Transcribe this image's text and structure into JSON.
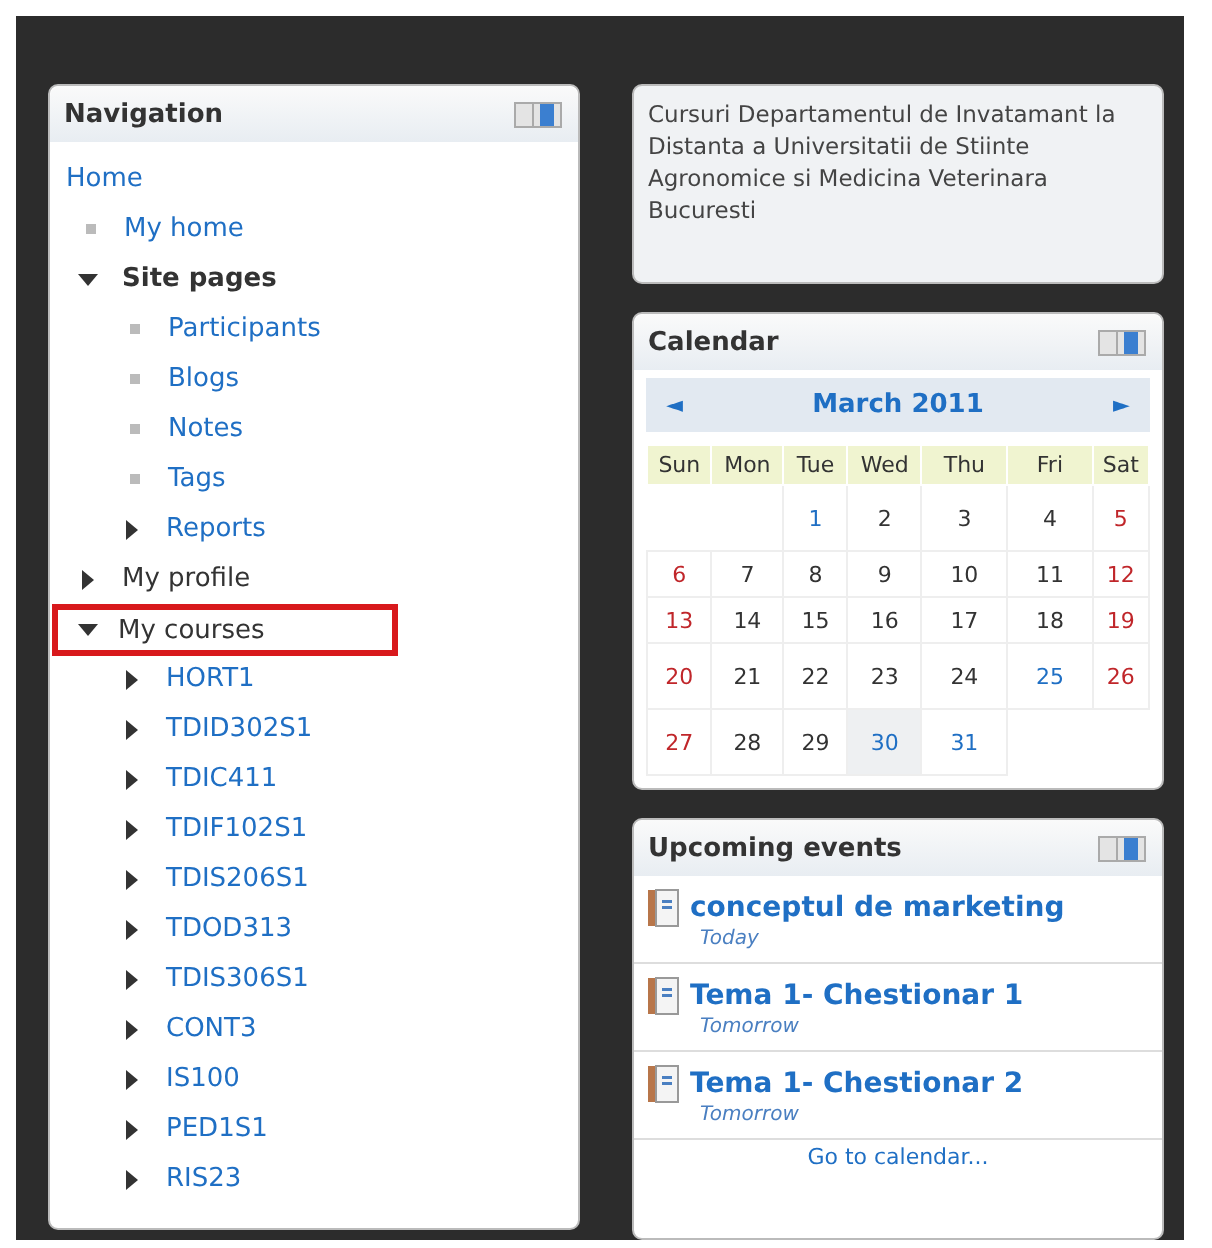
{
  "navigation": {
    "title": "Navigation",
    "items": [
      {
        "label": "Home",
        "kind": "root",
        "link": true
      },
      {
        "label": "My home",
        "kind": "leaf",
        "link": true
      },
      {
        "label": "Site pages",
        "kind": "branch",
        "link": false,
        "bold": true,
        "expanded": true,
        "children": [
          {
            "label": "Participants",
            "kind": "leaf",
            "link": true
          },
          {
            "label": "Blogs",
            "kind": "leaf",
            "link": true
          },
          {
            "label": "Notes",
            "kind": "leaf",
            "link": true
          },
          {
            "label": "Tags",
            "kind": "leaf",
            "link": true
          },
          {
            "label": "Reports",
            "kind": "branch",
            "link": true,
            "expanded": false
          }
        ]
      },
      {
        "label": "My profile",
        "kind": "branch",
        "link": false,
        "expanded": false
      },
      {
        "label": "My courses",
        "kind": "branch",
        "link": false,
        "expanded": true,
        "highlighted": true,
        "children": [
          {
            "label": "HORT1",
            "kind": "branch",
            "link": true,
            "expanded": false
          },
          {
            "label": "TDID302S1",
            "kind": "branch",
            "link": true,
            "expanded": false
          },
          {
            "label": "TDIC411",
            "kind": "branch",
            "link": true,
            "expanded": false
          },
          {
            "label": "TDIF102S1",
            "kind": "branch",
            "link": true,
            "expanded": false
          },
          {
            "label": "TDIS206S1",
            "kind": "branch",
            "link": true,
            "expanded": false
          },
          {
            "label": "TDOD313",
            "kind": "branch",
            "link": true,
            "expanded": false
          },
          {
            "label": "TDIS306S1",
            "kind": "branch",
            "link": true,
            "expanded": false
          },
          {
            "label": "CONT3",
            "kind": "branch",
            "link": true,
            "expanded": false
          },
          {
            "label": "IS100",
            "kind": "branch",
            "link": true,
            "expanded": false
          },
          {
            "label": "PED1S1",
            "kind": "branch",
            "link": true,
            "expanded": false
          },
          {
            "label": "RIS23",
            "kind": "branch",
            "link": true,
            "expanded": false
          }
        ]
      }
    ]
  },
  "info": {
    "text": "Cursuri Departamentul de Invatamant la Distanta a Universitatii de Stiinte Agronomice si Medicina Veterinara Bucuresti"
  },
  "calendar": {
    "title": "Calendar",
    "prev": "◄",
    "month": "March 2011",
    "next": "►",
    "weekdays": [
      "Sun",
      "Mon",
      "Tue",
      "Wed",
      "Thu",
      "Fri",
      "Sat"
    ],
    "weeks": [
      [
        {
          "kind": "blank"
        },
        {
          "kind": "blank"
        },
        {
          "day": "1",
          "kind": "event"
        },
        {
          "day": "2",
          "kind": "normal"
        },
        {
          "day": "3",
          "kind": "normal"
        },
        {
          "day": "4",
          "kind": "normal"
        },
        {
          "day": "5",
          "kind": "weekend"
        }
      ],
      [
        {
          "day": "6",
          "kind": "weekend"
        },
        {
          "day": "7",
          "kind": "normal"
        },
        {
          "day": "8",
          "kind": "normal"
        },
        {
          "day": "9",
          "kind": "normal"
        },
        {
          "day": "10",
          "kind": "normal"
        },
        {
          "day": "11",
          "kind": "normal"
        },
        {
          "day": "12",
          "kind": "weekend"
        }
      ],
      [
        {
          "day": "13",
          "kind": "weekend"
        },
        {
          "day": "14",
          "kind": "normal"
        },
        {
          "day": "15",
          "kind": "normal"
        },
        {
          "day": "16",
          "kind": "normal"
        },
        {
          "day": "17",
          "kind": "normal"
        },
        {
          "day": "18",
          "kind": "normal"
        },
        {
          "day": "19",
          "kind": "weekend"
        }
      ],
      [
        {
          "day": "20",
          "kind": "weekend"
        },
        {
          "day": "21",
          "kind": "normal"
        },
        {
          "day": "22",
          "kind": "normal"
        },
        {
          "day": "23",
          "kind": "normal"
        },
        {
          "day": "24",
          "kind": "normal"
        },
        {
          "day": "25",
          "kind": "event"
        },
        {
          "day": "26",
          "kind": "weekend"
        }
      ],
      [
        {
          "day": "27",
          "kind": "weekend"
        },
        {
          "day": "28",
          "kind": "normal"
        },
        {
          "day": "29",
          "kind": "normal"
        },
        {
          "day": "30",
          "kind": "today"
        },
        {
          "day": "31",
          "kind": "event"
        }
      ]
    ]
  },
  "upcoming": {
    "title": "Upcoming events",
    "events": [
      {
        "name": "conceptul de marketing",
        "when": "Today"
      },
      {
        "name": "Tema 1- Chestionar 1",
        "when": "Tomorrow"
      },
      {
        "name": "Tema 1- Chestionar 2",
        "when": "Tomorrow"
      }
    ],
    "footer_link": "Go to calendar..."
  }
}
